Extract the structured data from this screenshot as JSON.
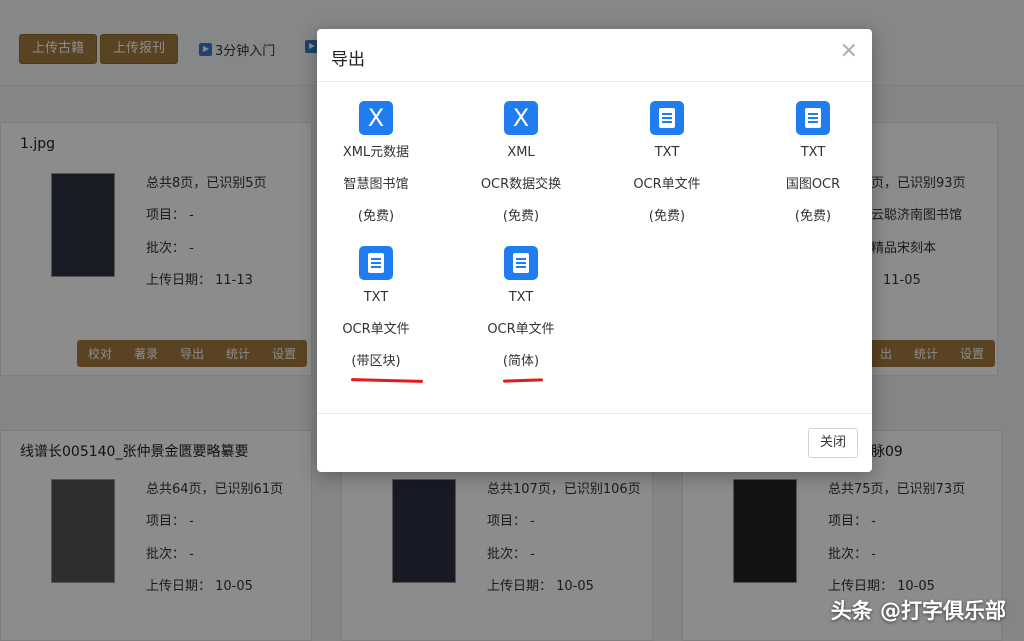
{
  "toolbar": {
    "upload_ancient": "上传古籍",
    "upload_newspaper": "上传报刊",
    "intro_link": "3分钟入门"
  },
  "cards": [
    {
      "title": "1.jpg",
      "total": "总共8页，已识别5页",
      "project": "项目： -",
      "batch": "批次： -",
      "date": "上传日期： 11-13"
    },
    {
      "title": "",
      "total": "页，已识别93页",
      "project": "云聪济南图书馆",
      "batch": "精品宋刻本",
      "date": "11-05"
    },
    {
      "title": "线谱长005140_张仲景金匮要略纂要",
      "total": "总共64页，已识别61页",
      "project": "项目： -",
      "batch": "批次： -",
      "date": "上传日期： 10-05"
    },
    {
      "title": "",
      "total": "总共107页，已识别106页",
      "project": "项目： -",
      "batch": "批次： -",
      "date": "上传日期： 10-05"
    },
    {
      "title": "脉09",
      "total": "总共75页，已识别73页",
      "project": "项目： -",
      "batch": "批次： -",
      "date": "上传日期： 10-05"
    }
  ],
  "card_actions": [
    "校对",
    "著录",
    "导出",
    "统计",
    "设置"
  ],
  "card_actions_right": [
    "出",
    "统计",
    "设置"
  ],
  "dialog": {
    "title": "导出",
    "close_button": "关闭",
    "options": [
      {
        "icon_text": "X",
        "line1": "XML元数据",
        "line2": "智慧图书馆",
        "line3": "(免费)"
      },
      {
        "icon_text": "X",
        "line1": "XML",
        "line2": "OCR数据交换",
        "line3": "(免费)"
      },
      {
        "icon_text": "",
        "line1": "TXT",
        "line2": "OCR单文件",
        "line3": "(免费)"
      },
      {
        "icon_text": "",
        "line1": "TXT",
        "line2": "国图OCR",
        "line3": "(免费)"
      },
      {
        "icon_text": "",
        "line1": "TXT",
        "line2": "OCR单文件",
        "line3": "(带区块)"
      },
      {
        "icon_text": "",
        "line1": "TXT",
        "line2": "OCR单文件",
        "line3": "(简体)"
      }
    ]
  },
  "watermark": "头条 @打字俱乐部",
  "colors": {
    "accent_gold": "#a37b3f",
    "icon_blue": "#1f7df0",
    "annotation_red": "#e11a1a"
  }
}
